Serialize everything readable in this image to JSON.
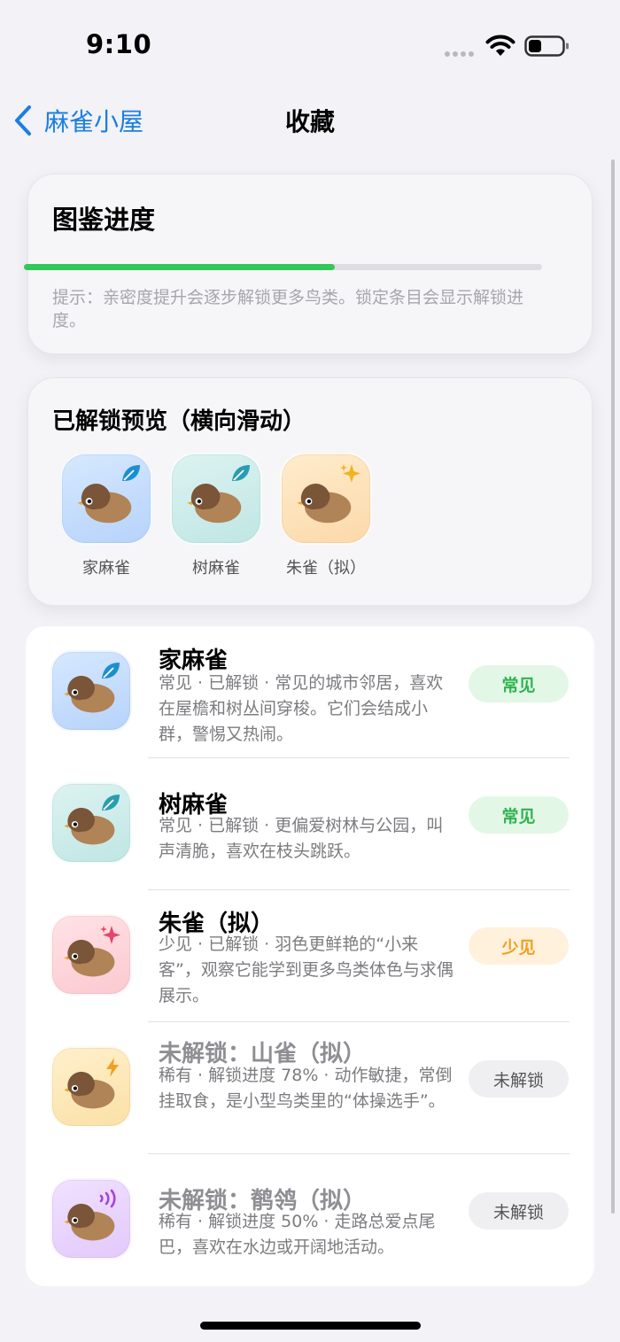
{
  "status_bar": {
    "time": "9:10"
  },
  "nav": {
    "back_label": "麻雀小屋",
    "title": "收藏"
  },
  "progress": {
    "title": "图鉴进度",
    "fraction": 0.6,
    "hint": "提示：亲密度提升会逐步解锁更多鸟类。锁定条目会显示解锁进度。",
    "fill_color": "#34c759"
  },
  "preview": {
    "title": "已解锁预览（横向滑动）",
    "items": [
      {
        "label": "家麻雀",
        "theme": "blue",
        "badge": "leaf-icon"
      },
      {
        "label": "树麻雀",
        "theme": "teal",
        "badge": "leaf-icon"
      },
      {
        "label": "朱雀（拟）",
        "theme": "orange",
        "badge": "sparkle-icon"
      }
    ]
  },
  "list": {
    "items": [
      {
        "title": "家麻雀",
        "desc": "常见 · 已解锁 · 常见的城市邻居，喜欢在屋檐和树丛间穿梭。它们会结成小群，警惕又热闹。",
        "tag": "常见",
        "tag_type": "common",
        "theme": "blue",
        "badge": "leaf-icon",
        "locked": false
      },
      {
        "title": "树麻雀",
        "desc": "常见 · 已解锁 · 更偏爱树林与公园，叫声清脆，喜欢在枝头跳跃。",
        "tag": "常见",
        "tag_type": "common",
        "theme": "teal",
        "badge": "leaf-icon",
        "locked": false
      },
      {
        "title": "朱雀（拟）",
        "desc": "少见 · 已解锁 · 羽色更鲜艳的“小来客”，观察它能学到更多鸟类体色与求偶展示。",
        "tag": "少见",
        "tag_type": "rare",
        "theme": "pink",
        "badge": "sparkle-icon",
        "locked": false
      },
      {
        "title": "未解锁：山雀（拟）",
        "desc": "稀有 · 解锁进度 78% · 动作敏捷，常倒挂取食，是小型鸟类里的“体操选手”。",
        "tag": "未解锁",
        "tag_type": "locked",
        "theme": "yellow",
        "badge": "bolt-icon",
        "locked": true
      },
      {
        "title": "未解锁：鹡鸰（拟）",
        "desc": "稀有 · 解锁进度 50% · 走路总爱点尾巴，喜欢在水边或开阔地活动。",
        "tag": "未解锁",
        "tag_type": "locked",
        "theme": "purple",
        "badge": "sound-icon",
        "locked": true
      }
    ]
  },
  "colors": {
    "accent": "#1a7fe0",
    "common": "#2fb34f",
    "rare": "#f0a020",
    "background": "#f2f2f7"
  }
}
